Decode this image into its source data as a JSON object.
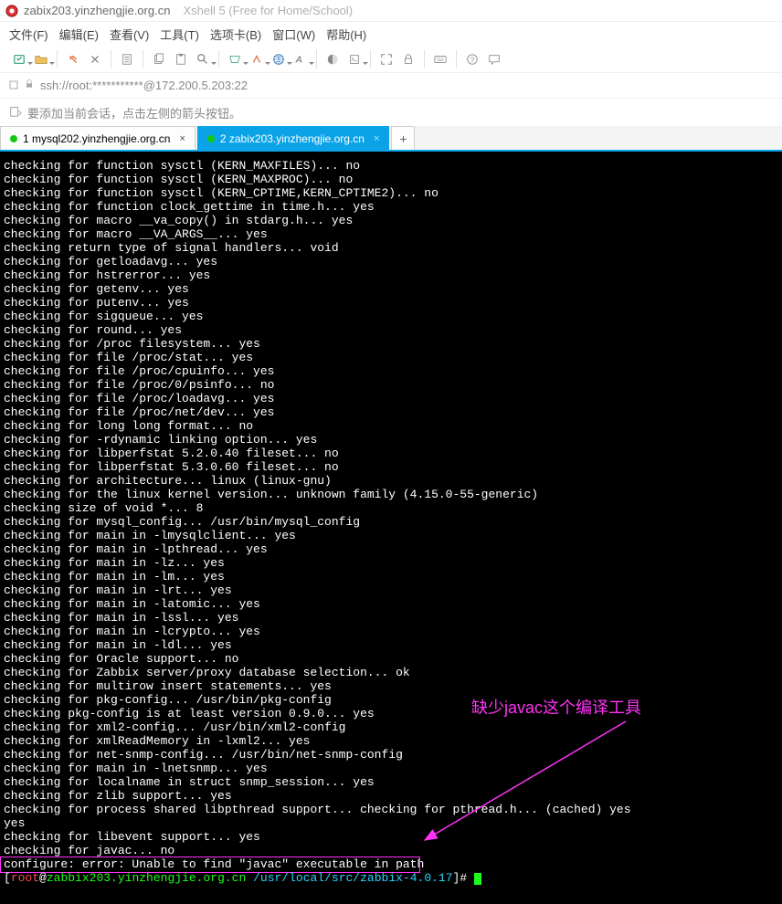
{
  "titlebar": {
    "main": "zabix203.yinzhengjie.org.cn",
    "sub": "Xshell 5 (Free for Home/School)"
  },
  "menubar": {
    "file": "文件(F)",
    "edit": "编辑(E)",
    "view": "查看(V)",
    "tools": "工具(T)",
    "tabs": "选项卡(B)",
    "window": "窗口(W)",
    "help": "帮助(H)"
  },
  "addressbar": {
    "url": "ssh://root:***********@172.200.5.203:22"
  },
  "hintbar": {
    "text": "要添加当前会话，点击左侧的箭头按钮。"
  },
  "tabs": [
    {
      "label": "1 mysql202.yinzhengjie.org.cn",
      "active": false
    },
    {
      "label": "2 zabix203.yinzhengjie.org.cn",
      "active": true
    }
  ],
  "terminal_lines": [
    "checking for function sysctl (KERN_MAXFILES)... no",
    "checking for function sysctl (KERN_MAXPROC)... no",
    "checking for function sysctl (KERN_CPTIME,KERN_CPTIME2)... no",
    "checking for function clock_gettime in time.h... yes",
    "checking for macro __va_copy() in stdarg.h... yes",
    "checking for macro __VA_ARGS__... yes",
    "checking return type of signal handlers... void",
    "checking for getloadavg... yes",
    "checking for hstrerror... yes",
    "checking for getenv... yes",
    "checking for putenv... yes",
    "checking for sigqueue... yes",
    "checking for round... yes",
    "checking for /proc filesystem... yes",
    "checking for file /proc/stat... yes",
    "checking for file /proc/cpuinfo... yes",
    "checking for file /proc/0/psinfo... no",
    "checking for file /proc/loadavg... yes",
    "checking for file /proc/net/dev... yes",
    "checking for long long format... no",
    "checking for -rdynamic linking option... yes",
    "checking for libperfstat 5.2.0.40 fileset... no",
    "checking for libperfstat 5.3.0.60 fileset... no",
    "checking for architecture... linux (linux-gnu)",
    "checking for the linux kernel version... unknown family (4.15.0-55-generic)",
    "checking size of void *... 8",
    "checking for mysql_config... /usr/bin/mysql_config",
    "checking for main in -lmysqlclient... yes",
    "checking for main in -lpthread... yes",
    "checking for main in -lz... yes",
    "checking for main in -lm... yes",
    "checking for main in -lrt... yes",
    "checking for main in -latomic... yes",
    "checking for main in -lssl... yes",
    "checking for main in -lcrypto... yes",
    "checking for main in -ldl... yes",
    "checking for Oracle support... no",
    "checking for Zabbix server/proxy database selection... ok",
    "checking for multirow insert statements... yes",
    "checking for pkg-config... /usr/bin/pkg-config",
    "checking pkg-config is at least version 0.9.0... yes",
    "checking for xml2-config... /usr/bin/xml2-config",
    "checking for xmlReadMemory in -lxml2... yes",
    "checking for net-snmp-config... /usr/bin/net-snmp-config",
    "checking for main in -lnetsnmp... yes",
    "checking for localname in struct snmp_session... yes",
    "checking for zlib support... yes",
    "checking for process shared libpthread support... checking for pthread.h... (cached) yes",
    "yes",
    "checking for libevent support... yes",
    "checking for javac... no",
    "configure: error: Unable to find \"javac\" executable in path"
  ],
  "prompt": {
    "open": "[",
    "user": "root",
    "at": "@",
    "host": "zabbix203.yinzhengjie.org.cn",
    "space": " ",
    "path": "/usr/local/src/zabbix-4.0.17",
    "close": "]# "
  },
  "annotation": {
    "text": "缺少javac这个编译工具"
  }
}
